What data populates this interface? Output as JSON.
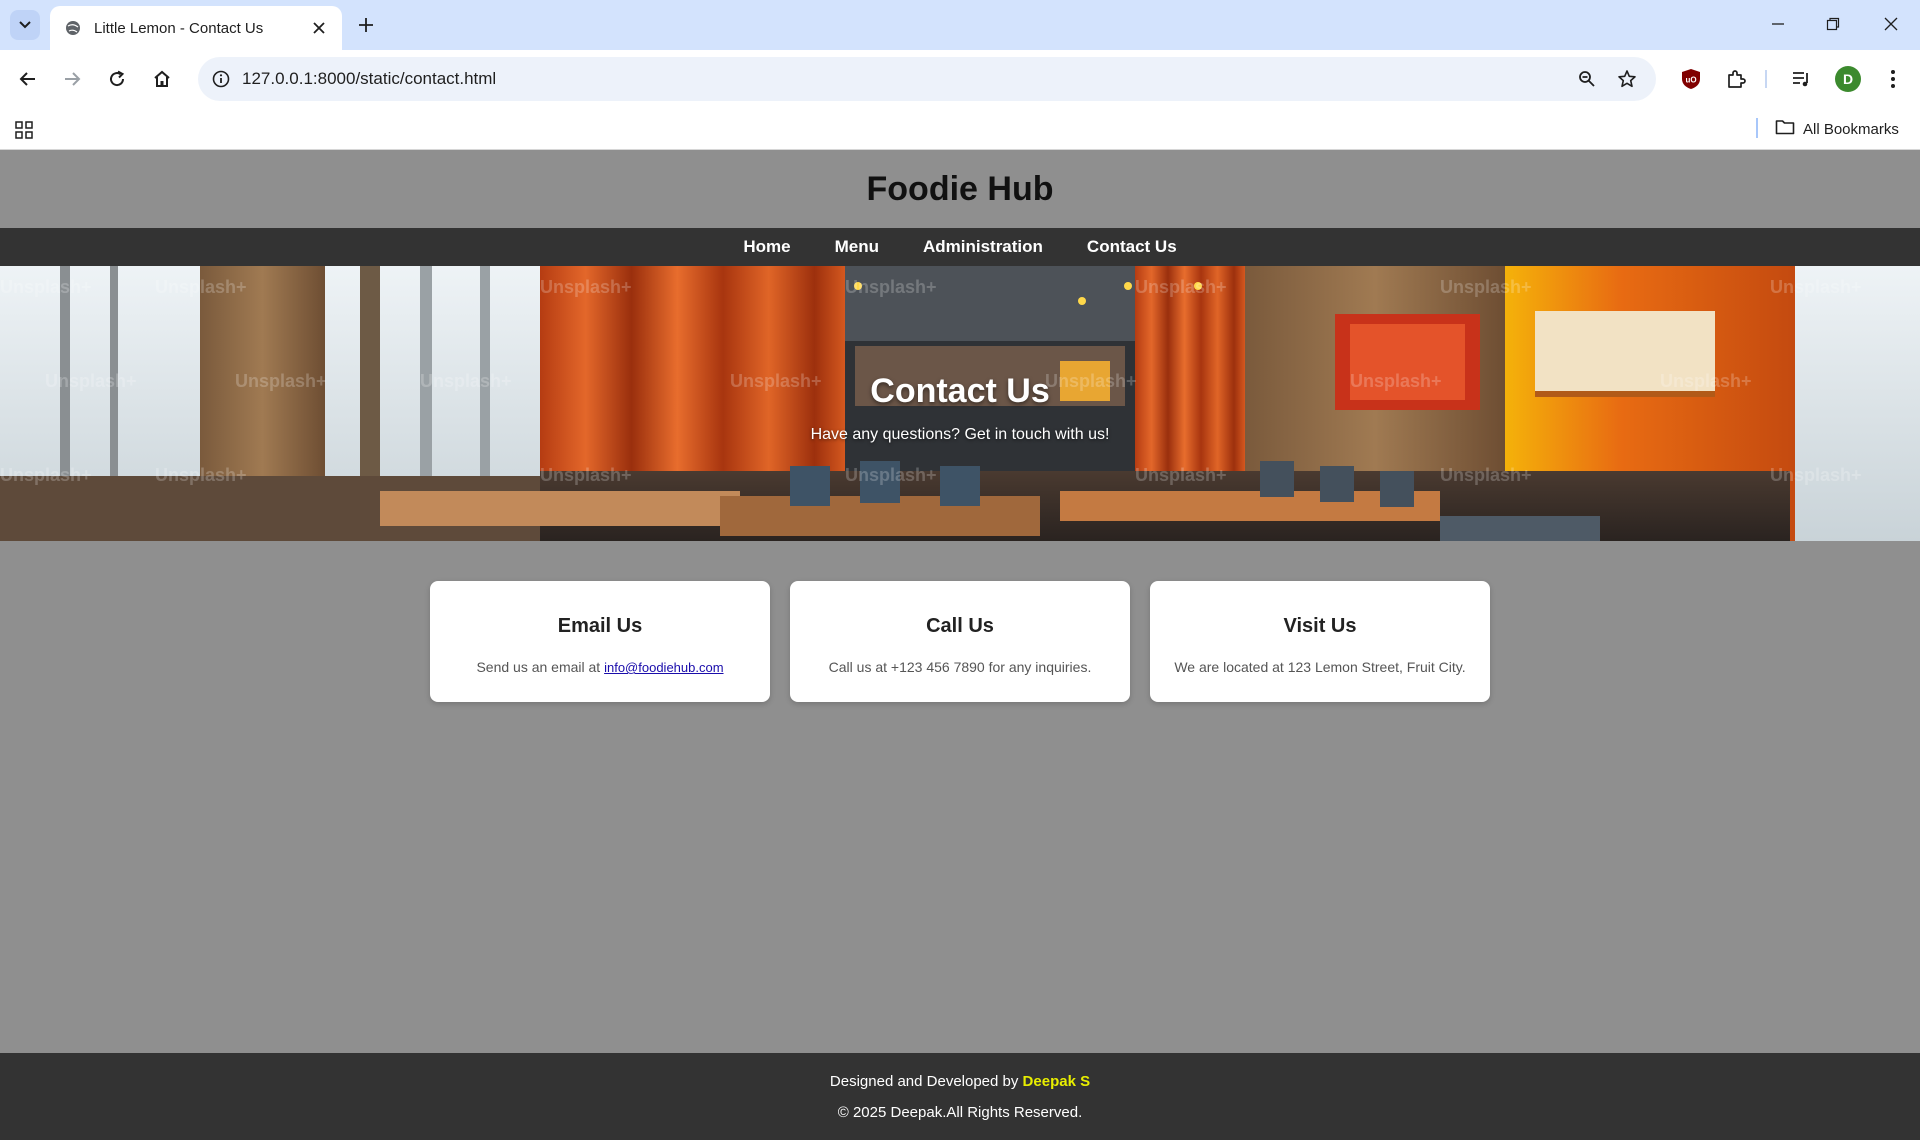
{
  "browser": {
    "tab_title": "Little Lemon - Contact Us",
    "url": "127.0.0.1:8000/static/contact.html",
    "profile_initial": "D",
    "all_bookmarks_label": "All Bookmarks",
    "icons": [
      "tab-list-icon",
      "globe-icon",
      "close-icon",
      "plus-icon",
      "minimize-icon",
      "restore-icon",
      "window-close-icon",
      "back-icon",
      "forward-icon",
      "reload-icon",
      "home-icon",
      "info-icon",
      "zoom-icon",
      "star-icon",
      "ublock-icon",
      "extensions-icon",
      "media-icon",
      "menu-icon",
      "apps-icon",
      "folder-icon"
    ]
  },
  "site": {
    "title": "Foodie Hub",
    "nav": [
      "Home",
      "Menu",
      "Administration",
      "Contact Us"
    ]
  },
  "hero": {
    "title": "Contact Us",
    "subtitle": "Have any questions? Get in touch with us!",
    "watermark": "Unsplash+"
  },
  "cards": [
    {
      "title": "Email Us",
      "text_prefix": "Send us an email at ",
      "link": "info@foodiehub.com"
    },
    {
      "title": "Call Us",
      "text": "Call us at +123 456 7890 for any inquiries."
    },
    {
      "title": "Visit Us",
      "text": "We are located at 123 Lemon Street, Fruit City."
    }
  ],
  "footer": {
    "credit_prefix": "Designed and Developed by ",
    "author": "Deepak S",
    "copyright": "© 2025 Deepak.All Rights Reserved."
  },
  "colors": {
    "page_bg": "#8f8f8f",
    "nav_bg": "#333333",
    "footer_bg": "#333333",
    "author_accent": "#e8ee00",
    "link": "#1a0dab"
  }
}
